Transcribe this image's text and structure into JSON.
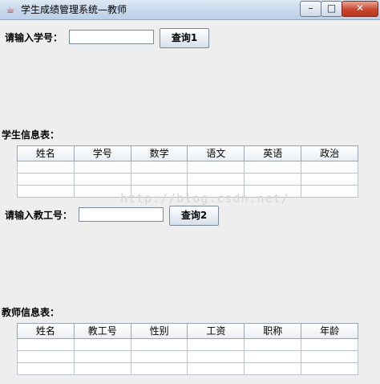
{
  "window": {
    "title": "学生成绩管理系统—教师",
    "min_symbol": "–",
    "max_symbol": "□",
    "close_symbol": "✕",
    "icon": "java-cup-icon"
  },
  "student_query": {
    "label": "请输入学号：",
    "input_value": "",
    "button_label": "查询1"
  },
  "student_table": {
    "caption": "学生信息表：",
    "columns": [
      "姓名",
      "学号",
      "数学",
      "语文",
      "英语",
      "政治"
    ],
    "rows": [
      [
        "",
        "",
        "",
        "",
        "",
        ""
      ],
      [
        "",
        "",
        "",
        "",
        "",
        ""
      ],
      [
        "",
        "",
        "",
        "",
        "",
        ""
      ]
    ]
  },
  "teacher_query": {
    "label": "请输入教工号：",
    "input_value": "",
    "button_label": "查询2"
  },
  "teacher_table": {
    "caption": "教师信息表：",
    "columns": [
      "姓名",
      "教工号",
      "性别",
      "工资",
      "职称",
      "年龄"
    ],
    "rows": [
      [
        "",
        "",
        "",
        "",
        "",
        ""
      ],
      [
        "",
        "",
        "",
        "",
        "",
        ""
      ],
      [
        "",
        "",
        "",
        "",
        "",
        ""
      ]
    ]
  },
  "watermark": "http://blog.csdn.net/"
}
